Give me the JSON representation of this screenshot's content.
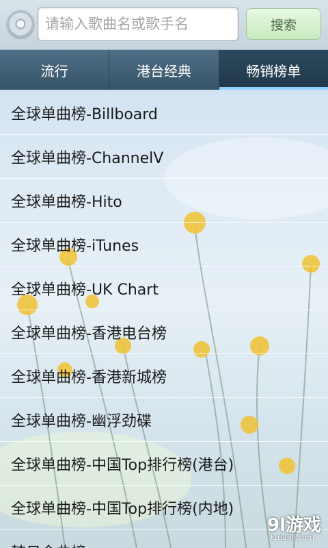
{
  "search": {
    "placeholder": "请输入歌曲名或歌手名",
    "button_label": "搜索"
  },
  "tabs": [
    {
      "label": "流行",
      "active": false
    },
    {
      "label": "港台经典",
      "active": false
    },
    {
      "label": "畅销榜单",
      "active": true
    }
  ],
  "list": {
    "items": [
      {
        "label": "全球单曲榜-Billboard"
      },
      {
        "label": "全球单曲榜-ChannelV"
      },
      {
        "label": "全球单曲榜-Hito"
      },
      {
        "label": "全球单曲榜-iTunes"
      },
      {
        "label": "全球单曲榜-UK Chart"
      },
      {
        "label": "全球单曲榜-香港电台榜"
      },
      {
        "label": "全球单曲榜-香港新城榜"
      },
      {
        "label": "全球单曲榜-幽浮劲碟"
      },
      {
        "label": "全球单曲榜-中国Top排行榜(港台)"
      },
      {
        "label": "全球单曲榜-中国Top排行榜(内地)"
      },
      {
        "label": "韩日金曲榜"
      }
    ]
  },
  "watermark": {
    "logo": "9l游戏",
    "url": "91danji.com"
  },
  "colors": {
    "tab_bar": "#3f5d74",
    "tab_active": "#243f51",
    "tab_indicator": "#8fd0ff",
    "search_button": "#c8ebbf"
  }
}
